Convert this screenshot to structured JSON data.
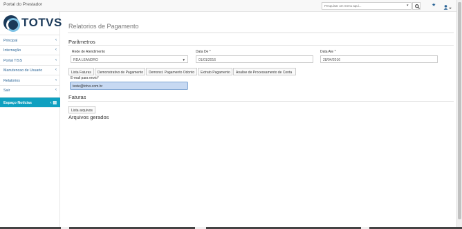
{
  "header": {
    "title": "Portal do Prestador",
    "search_placeholder": "Pesquisar um menu aqui...",
    "icons": [
      "search-icon",
      "star-icon",
      "user-icon"
    ],
    "star_glyph": "★"
  },
  "logo": {
    "text": "TOTVS"
  },
  "sidebar": {
    "items": [
      {
        "label": "Principal"
      },
      {
        "label": "Internação"
      },
      {
        "label": "Portal TISS"
      },
      {
        "label": "Manutencao de Usuario"
      },
      {
        "label": "Relatorios"
      },
      {
        "label": "Sair"
      }
    ],
    "active_item": {
      "label": "Espaço Notícias"
    },
    "accent_color": "#0fa0c0"
  },
  "page": {
    "title": "Relatorios de Pagamento",
    "params_heading": "Parâmetros",
    "rede_label": "Rede de Atendimento",
    "rede_value": "RDA LEANDRO",
    "data_de_label": "Data De *",
    "data_de_value": "01/01/2016",
    "data_ate_label": "Data Ate *",
    "data_ate_value": "28/04/2016",
    "tabs": [
      {
        "label": "Lista Faturas"
      },
      {
        "label": "Demonstrativo de Pagamento"
      },
      {
        "label": "Demonst. Pagamento Odonto"
      },
      {
        "label": "Extrato Pagamento"
      },
      {
        "label": "Analise de Processamento de Conta"
      }
    ],
    "email_label": "E-mail para envio*",
    "email_value": "teste@totvs.com.br",
    "faturas_heading": "Faturas",
    "lista_arquivos_label": "Lista arquivos",
    "arquivos_heading": "Arquivos gerados"
  }
}
